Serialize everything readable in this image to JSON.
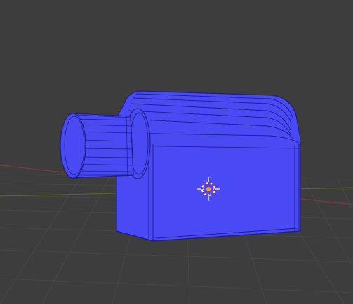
{
  "viewport": {
    "view": "perspective",
    "background_color": "#3d3d3d",
    "grid": {
      "visible": true,
      "line_color": "#474747",
      "x_axis_color": "#7a3a3a",
      "y_axis_color": "#5b6a2a"
    }
  },
  "object": {
    "selected": true,
    "shading": "wireframe-overlay",
    "face_color": "#4a4af5",
    "edge_color": "#1e1e8c",
    "parts": [
      "body",
      "rounded-top",
      "front-lip",
      "cylinder-boss",
      "cylinder-cap"
    ]
  },
  "cursor_3d": {
    "visible": true,
    "ring_colors": [
      "#ffffff",
      "#e2231a"
    ],
    "origin_dot_color": "#ff9a1f"
  }
}
